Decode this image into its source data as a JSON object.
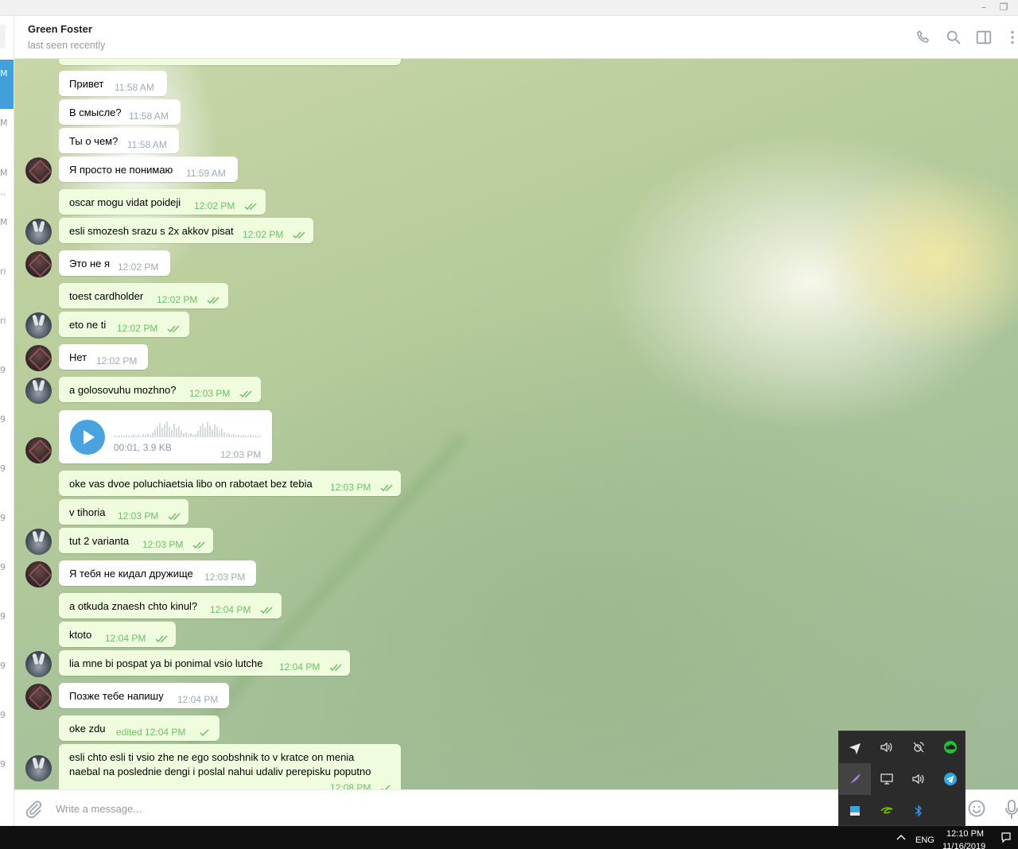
{
  "chat": {
    "name": "Green Foster",
    "status": "last seen recently"
  },
  "sidebar_fragments": [
    "M",
    "M",
    "M",
    "..",
    "M",
    "ri",
    "ri",
    "9",
    "9",
    "9",
    "9",
    "9",
    "9",
    "9",
    "9",
    "9"
  ],
  "messages": [
    {
      "dir": "in",
      "avatar": "",
      "text": "Привет",
      "time": "11:58 AM"
    },
    {
      "dir": "in",
      "avatar": "",
      "text": "В смысле?",
      "time": "11:58 AM"
    },
    {
      "dir": "in",
      "avatar": "",
      "text": "Ты о чем?",
      "time": "11:58 AM"
    },
    {
      "dir": "in",
      "avatar": "dark",
      "text": "Я просто не понимаю",
      "time": "11:59 AM"
    },
    {
      "dir": "out",
      "avatar": "",
      "text": "oscar mogu vidat poideji",
      "time": "12:02 PM"
    },
    {
      "dir": "out",
      "avatar": "bunny",
      "text": "esli smozesh srazu s 2x akkov pisat",
      "time": "12:02 PM"
    },
    {
      "dir": "in",
      "avatar": "dark",
      "text": "Это не я",
      "time": "12:02 PM"
    },
    {
      "dir": "out",
      "avatar": "",
      "text": "toest cardholder",
      "time": "12:02 PM"
    },
    {
      "dir": "out",
      "avatar": "bunny",
      "text": "eto ne ti",
      "time": "12:02 PM"
    },
    {
      "dir": "in",
      "avatar": "dark",
      "text": "Нет",
      "time": "12:02 PM"
    },
    {
      "dir": "out",
      "avatar": "bunny",
      "text": "a golosovuhu mozhno?",
      "time": "12:03 PM"
    },
    {
      "dir": "out",
      "avatar": "",
      "text": "oke vas dvoe poluchiaetsia libo on rabotaet bez tebia",
      "time": "12:03 PM"
    },
    {
      "dir": "out",
      "avatar": "",
      "text": "v tihoria",
      "time": "12:03 PM"
    },
    {
      "dir": "out",
      "avatar": "bunny",
      "text": "tut 2 varianta",
      "time": "12:03 PM"
    },
    {
      "dir": "in",
      "avatar": "dark",
      "text": "Я тебя не кидал дружище",
      "time": "12:03 PM"
    },
    {
      "dir": "out",
      "avatar": "",
      "text": "a otkuda znaesh chto kinul?",
      "time": "12:04 PM"
    },
    {
      "dir": "out",
      "avatar": "",
      "text": "ktoto",
      "time": "12:04 PM"
    },
    {
      "dir": "out",
      "avatar": "bunny",
      "text": "lia mne bi pospat ya bi ponimal vsio lutche",
      "time": "12:04 PM"
    },
    {
      "dir": "in",
      "avatar": "dark",
      "text": "Позже тебе напишу",
      "time": "12:04 PM"
    },
    {
      "dir": "out",
      "avatar": "",
      "text": "oke zdu",
      "time": "edited 12:04 PM"
    },
    {
      "dir": "out",
      "avatar": "bunny",
      "text_line1": "esli chto esli ti vsio zhe ne ego soobshnik to v kratce on menia",
      "text_line2": "naebal na poslednie dengi i poslal nahui udaliv perepisku poputno",
      "time": "12:08 PM"
    }
  ],
  "voice": {
    "avatar": "dark",
    "info": "00:01, 3.9 KB",
    "time": "12:03 PM"
  },
  "composer": {
    "placeholder": "Write a message..."
  },
  "tray_icons": [
    "plane-icon",
    "volume-icon",
    "satellite-icon",
    "cloud-icon",
    "feather-icon",
    "display-icon",
    "speaker-icon",
    "telegram-icon",
    "app-icon",
    "nvidia-icon",
    "bluetooth-icon"
  ],
  "taskbar": {
    "lang": "ENG",
    "time": "12:10 PM",
    "date": "11/16/2019"
  },
  "colors": {
    "accent": "#419fd9",
    "out_bubble": "#effdde",
    "out_time": "#6cc264",
    "in_time": "#a0acb6"
  }
}
